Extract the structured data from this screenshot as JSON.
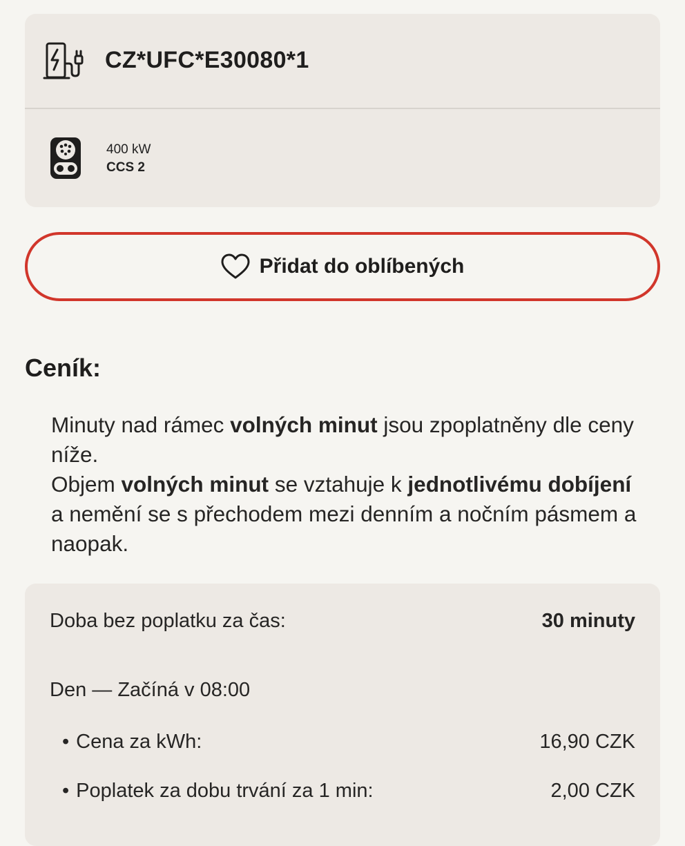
{
  "station": {
    "id": "CZ*UFC*E30080*1",
    "icon": "ev-charger-icon"
  },
  "connector": {
    "icon": "ccs2-connector-icon",
    "power": "400 kW",
    "type": "CCS 2"
  },
  "favorite_button": {
    "icon": "heart-icon",
    "label": "Přidat do oblíbených"
  },
  "pricing": {
    "title": "Ceník:",
    "info": {
      "p1_a": "Minuty nad rámec ",
      "p1_b": "volných minut",
      "p1_c": " jsou zpoplatněny dle ceny níže.",
      "p2_a": "Objem ",
      "p2_b": "volných minut",
      "p2_c": " se vztahuje k ",
      "p2_d": "jednotlivému dobíjení",
      "p2_e": " a nemění se s přechodem mezi denním a nočním pásmem a naopak."
    },
    "free_time_label": "Doba bez poplatku za čas:",
    "free_time_value": "30 minuty",
    "day_heading": "Den — Začíná v 08:00",
    "bullet": "•",
    "kwh_label": "Cena za kWh:",
    "kwh_value": "16,90 CZK",
    "minute_label": "Poplatek za dobu trvání za 1 min:",
    "minute_value": "2,00 CZK"
  },
  "colors": {
    "accent": "#d1362b",
    "card": "#ede9e4",
    "background": "#f6f5f1"
  }
}
